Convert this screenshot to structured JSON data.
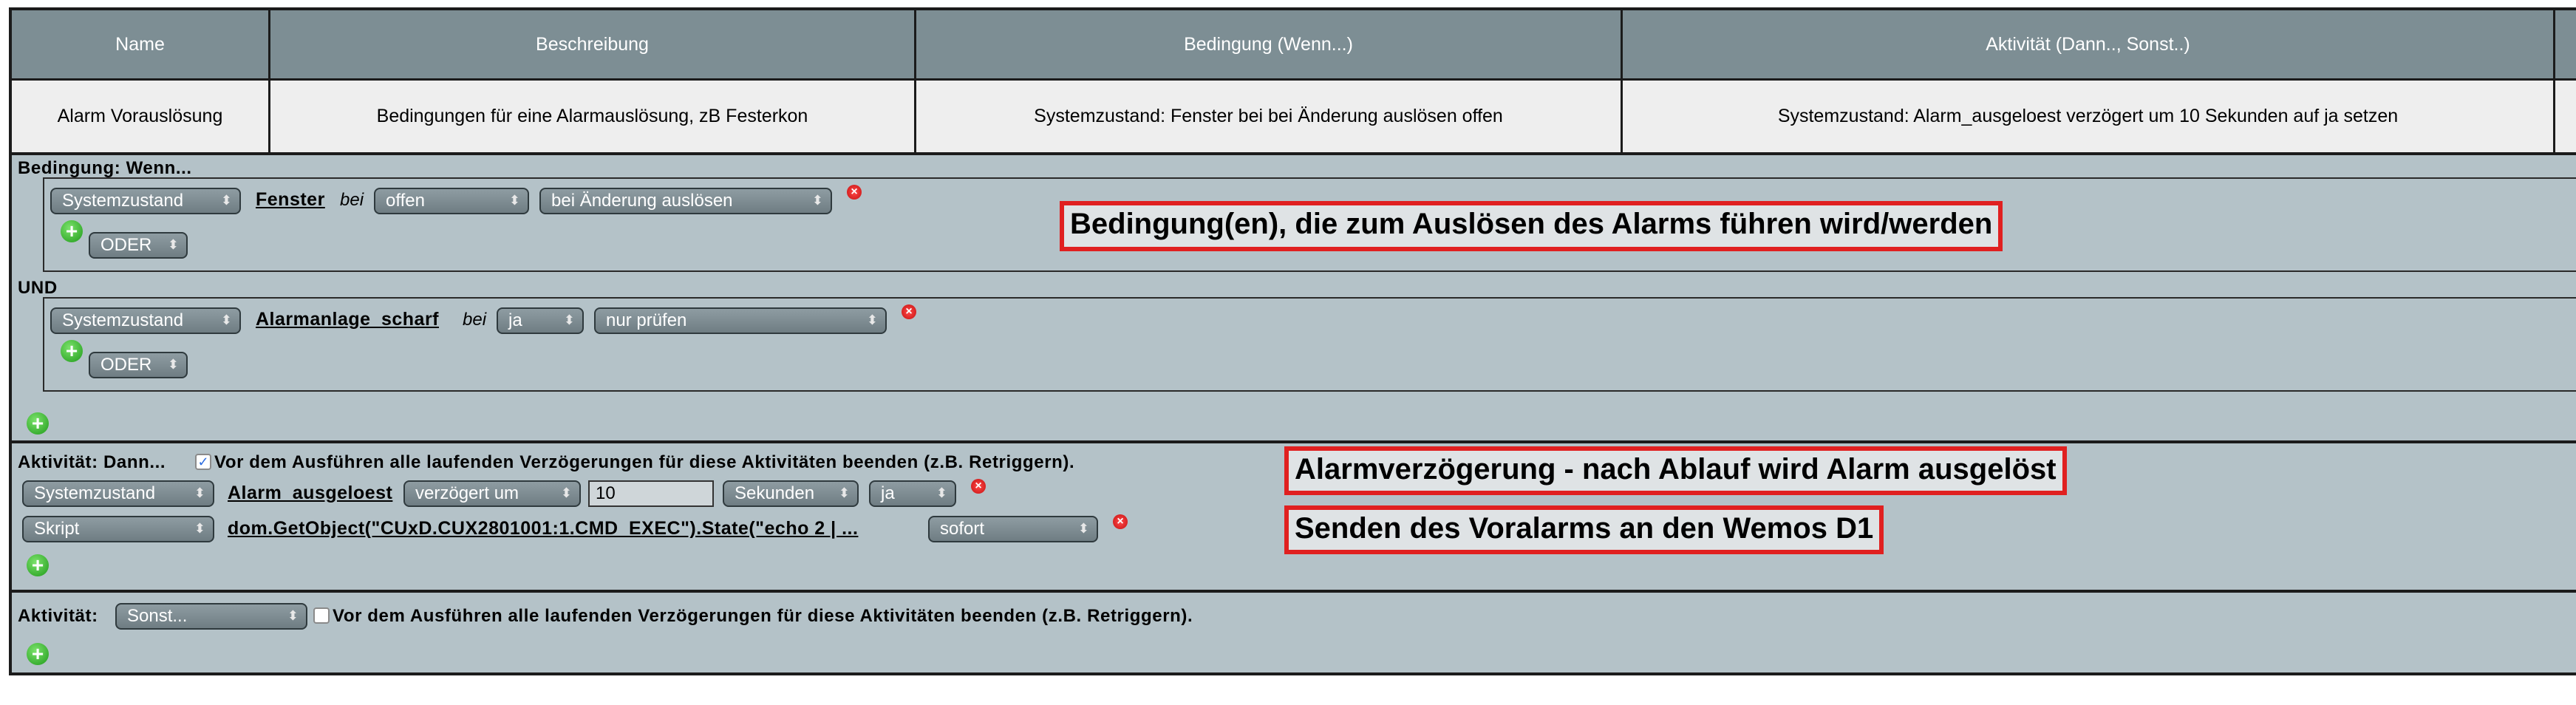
{
  "table": {
    "headers": [
      "Name",
      "Beschreibung",
      "Bedingung (Wenn...)",
      "Aktivität (Dann.., Sonst..)"
    ],
    "row": {
      "name": "Alarm Vorauslösung",
      "beschreibung": "Bedingungen für eine Alarmauslösung, zB Festerkon",
      "bedingung": "Systemzustand: Fenster bei bei Änderung auslösen offen",
      "aktivitaet": "Systemzustand: Alarm_ausgeloest verzögert um 10 Sekunden auf ja setzen"
    }
  },
  "condition": {
    "title": "Bedingung: Wenn...",
    "block1": {
      "type": "Systemzustand",
      "name": "Fenster",
      "bei": "bei",
      "value": "offen",
      "trigger": "bei Änderung auslösen",
      "oder": "ODER"
    },
    "und": "UND",
    "block2": {
      "type": "Systemzustand",
      "name": "Alarmanlage_scharf",
      "bei": "bei",
      "value": "ja",
      "trigger": "nur prüfen",
      "oder": "ODER"
    }
  },
  "activity": {
    "title": "Aktivität: Dann...",
    "checkbox_label": "Vor dem Ausführen alle laufenden Verzögerungen für diese Aktivitäten beenden (z.B. Retriggern).",
    "checkbox_checked": true,
    "line1": {
      "type": "Systemzustand",
      "name": "Alarm_ausgeloest",
      "mode": "verzögert um",
      "delay": "10",
      "unit": "Sekunden",
      "value": "ja"
    },
    "line2": {
      "type": "Skript",
      "script": "dom.GetObject(\"CUxD.CUX2801001:1.CMD_EXEC\").State(\"echo 2 | ...",
      "timing": "sofort"
    }
  },
  "else_activity": {
    "title": "Aktivität:",
    "select": "Sonst...",
    "checkbox_label": "Vor dem Ausführen alle laufenden Verzögerungen für diese Aktivitäten beenden (z.B. Retriggern).",
    "checkbox_checked": false
  },
  "annotations": {
    "note1": "Bedingung(en), die zum Auslösen des Alarms führen wird/werden",
    "note2": "Alarmverzögerung - nach Ablauf wird Alarm ausgelöst",
    "note3": "Senden des Voralarms an den Wemos D1"
  },
  "colors": {
    "annotation_border": "#e02020",
    "panel": "#b4c2c8",
    "header": "#7d8e94"
  }
}
